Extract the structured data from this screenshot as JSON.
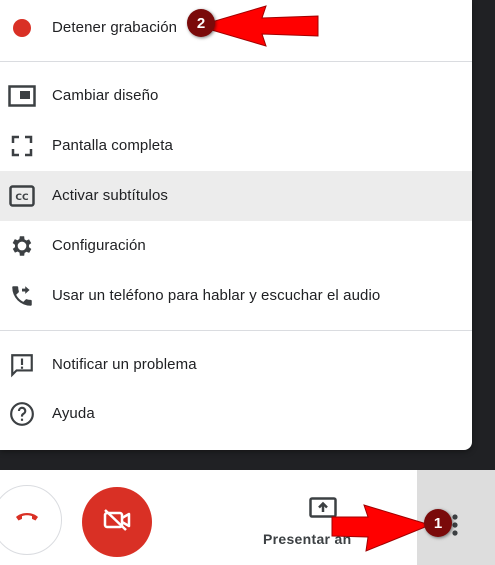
{
  "menu": {
    "items": [
      {
        "label": "Detener grabación",
        "icon": "record-dot-icon"
      },
      {
        "label": "Cambiar diseño",
        "icon": "layout-icon"
      },
      {
        "label": "Pantalla completa",
        "icon": "fullscreen-icon"
      },
      {
        "label": "Activar subtítulos",
        "icon": "closed-captions-icon"
      },
      {
        "label": "Configuración",
        "icon": "gear-icon"
      },
      {
        "label": "Usar un teléfono para hablar y escuchar el audio",
        "icon": "phone-forward-icon"
      },
      {
        "label": "Notificar un problema",
        "icon": "report-problem-icon"
      },
      {
        "label": "Ayuda",
        "icon": "help-icon"
      }
    ],
    "highlighted_index": 3
  },
  "bottom_bar": {
    "present_label": "Presentar ah",
    "present_icon": "present-screen-icon",
    "hangup_icon": "hang-up-icon",
    "camera_icon": "camera-off-icon",
    "more_icon": "more-vert-icon"
  },
  "annotations": {
    "badge1": "1",
    "badge2": "2"
  },
  "colors": {
    "record": "#d93025",
    "camera_button": "#d93025",
    "annotation_arrow": "#ff0000",
    "annotation_badge": "#7a0a0a"
  }
}
